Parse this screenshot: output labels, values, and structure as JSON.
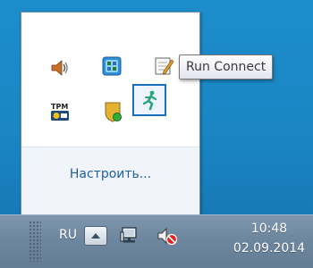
{
  "tray_flyout": {
    "icons": [
      {
        "name": "volume-icon"
      },
      {
        "name": "calculator-app-icon"
      },
      {
        "name": "notepad-edit-icon"
      },
      {
        "name": "tpm-icon",
        "label": "TPM"
      },
      {
        "name": "shield-security-icon"
      },
      {
        "name": "run-connect-icon"
      }
    ],
    "customize_label": "Настроить..."
  },
  "tooltip": {
    "text": "Run Connect"
  },
  "taskbar": {
    "language": "RU",
    "clock": {
      "time": "10:48",
      "date": "02.09.2014"
    },
    "colors": {
      "taskbar": "#6e879f",
      "desktop": "#1b88c7",
      "link": "#1f5fa8",
      "selection": "#1b6fc0"
    }
  }
}
